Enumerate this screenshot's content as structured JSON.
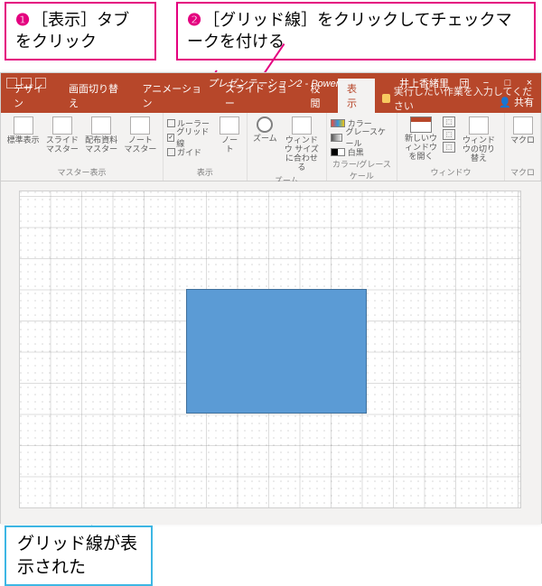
{
  "callouts": {
    "c1_num": "❶",
    "c1_text": "［表示］タブをクリック",
    "c2_num": "❷",
    "c2_text": "［グリッド線］をクリックしてチェックマークを付ける",
    "c3_text": "グリッド線が表示された"
  },
  "titlebar": {
    "title": "プレゼンテーション2 - PowerPoint",
    "user": "井上香緒里",
    "icon1": "団",
    "min": "−",
    "max": "□",
    "close": "×"
  },
  "tabs": {
    "t1": "デザイン",
    "t2": "画面切り替え",
    "t3": "アニメーション",
    "t4": "スライド ショー",
    "t5": "校閲",
    "t6": "表示",
    "tell": "実行したい作業を入力してください",
    "share": "共有",
    "share_icon": "👤"
  },
  "ribbon": {
    "g1": {
      "btn1": "標準表示",
      "btn2": "スライド マスター",
      "btn3": "配布資料 マスター",
      "btn4": "ノート マスター",
      "label": "マスター表示"
    },
    "g2": {
      "chk1": "ルーラー",
      "chk2": "グリッド線",
      "chk2_checked": "✓",
      "chk3": "ガイド",
      "btn1": "ノート",
      "label": "表示"
    },
    "g3": {
      "btn1": "ズーム",
      "btn2": "ウィンドウ サイズに合わせる",
      "label": "ズーム"
    },
    "g4": {
      "opt1": "カラー",
      "opt2": "グレースケール",
      "opt3": "白黒",
      "label": "カラー/グレースケール"
    },
    "g5": {
      "btn1": "新しいウィンドウを開く",
      "btn2a": "⬚",
      "btn2b": "⬚",
      "btn2c": "⬚",
      "btn3": "ウィンドウの切り替え",
      "label": "ウィンドウ"
    },
    "g6": {
      "btn1": "マクロ",
      "label": "マクロ"
    }
  },
  "colors": {
    "accent": "#b7472a",
    "callout_pink": "#e4007f",
    "callout_blue": "#3db7e4",
    "shape_fill": "#5b9bd5"
  }
}
